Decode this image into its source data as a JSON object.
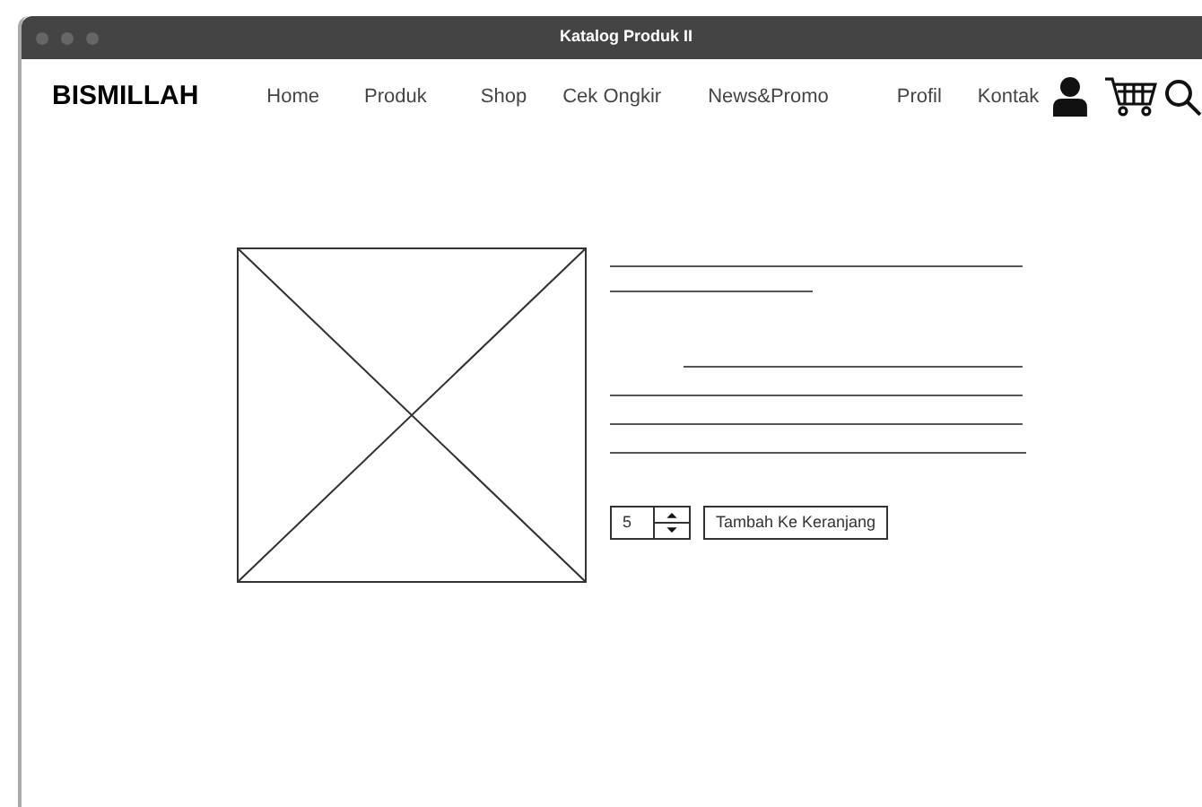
{
  "window": {
    "title": "Katalog Produk II"
  },
  "brand": "BISMILLAH",
  "nav": [
    {
      "label": "Home"
    },
    {
      "label": "Produk"
    },
    {
      "label": "Shop"
    },
    {
      "label": "Cek Ongkir"
    },
    {
      "label": "News&Promo"
    },
    {
      "label": "Profil"
    },
    {
      "label": "Kontak"
    }
  ],
  "quantity": {
    "value": "5"
  },
  "add_button": "Tambah Ke Keranjang"
}
